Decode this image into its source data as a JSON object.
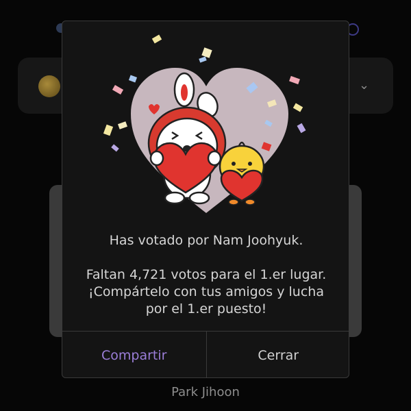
{
  "background": {
    "nominee_name": "Park Jihoon"
  },
  "dialog": {
    "message_line1": "Has votado por Nam Joohyuk.",
    "message_line2": "Faltan 4,721 votos para el 1.er lugar.",
    "message_line3": "¡Compártelo con tus amigos y lucha",
    "message_line4": "por el 1.er puesto!",
    "share_label": "Compartir",
    "close_label": "Cerrar"
  },
  "colors": {
    "accent": "#9b7ed8",
    "dialog_bg": "#141414",
    "heart_bg": "#c7b7be",
    "heart_red": "#e0342f"
  },
  "icons": [
    "coin-icon",
    "chevron-down-icon",
    "bunny-with-heart-icon",
    "chick-with-heart-icon",
    "confetti-icon"
  ]
}
